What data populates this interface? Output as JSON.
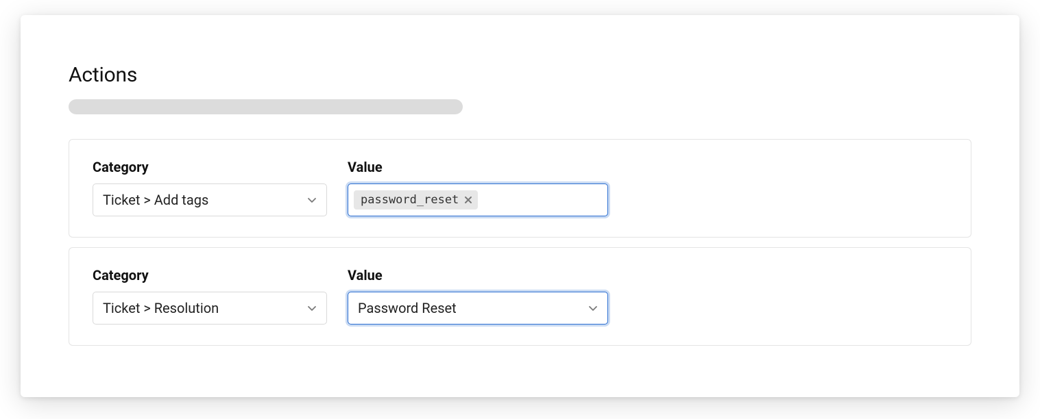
{
  "section": {
    "title": "Actions"
  },
  "labels": {
    "category": "Category",
    "value": "Value"
  },
  "actions": [
    {
      "category": "Ticket > Add tags",
      "value_type": "tags",
      "tags": [
        "password_reset"
      ]
    },
    {
      "category": "Ticket > Resolution",
      "value_type": "select",
      "value": "Password Reset"
    }
  ]
}
